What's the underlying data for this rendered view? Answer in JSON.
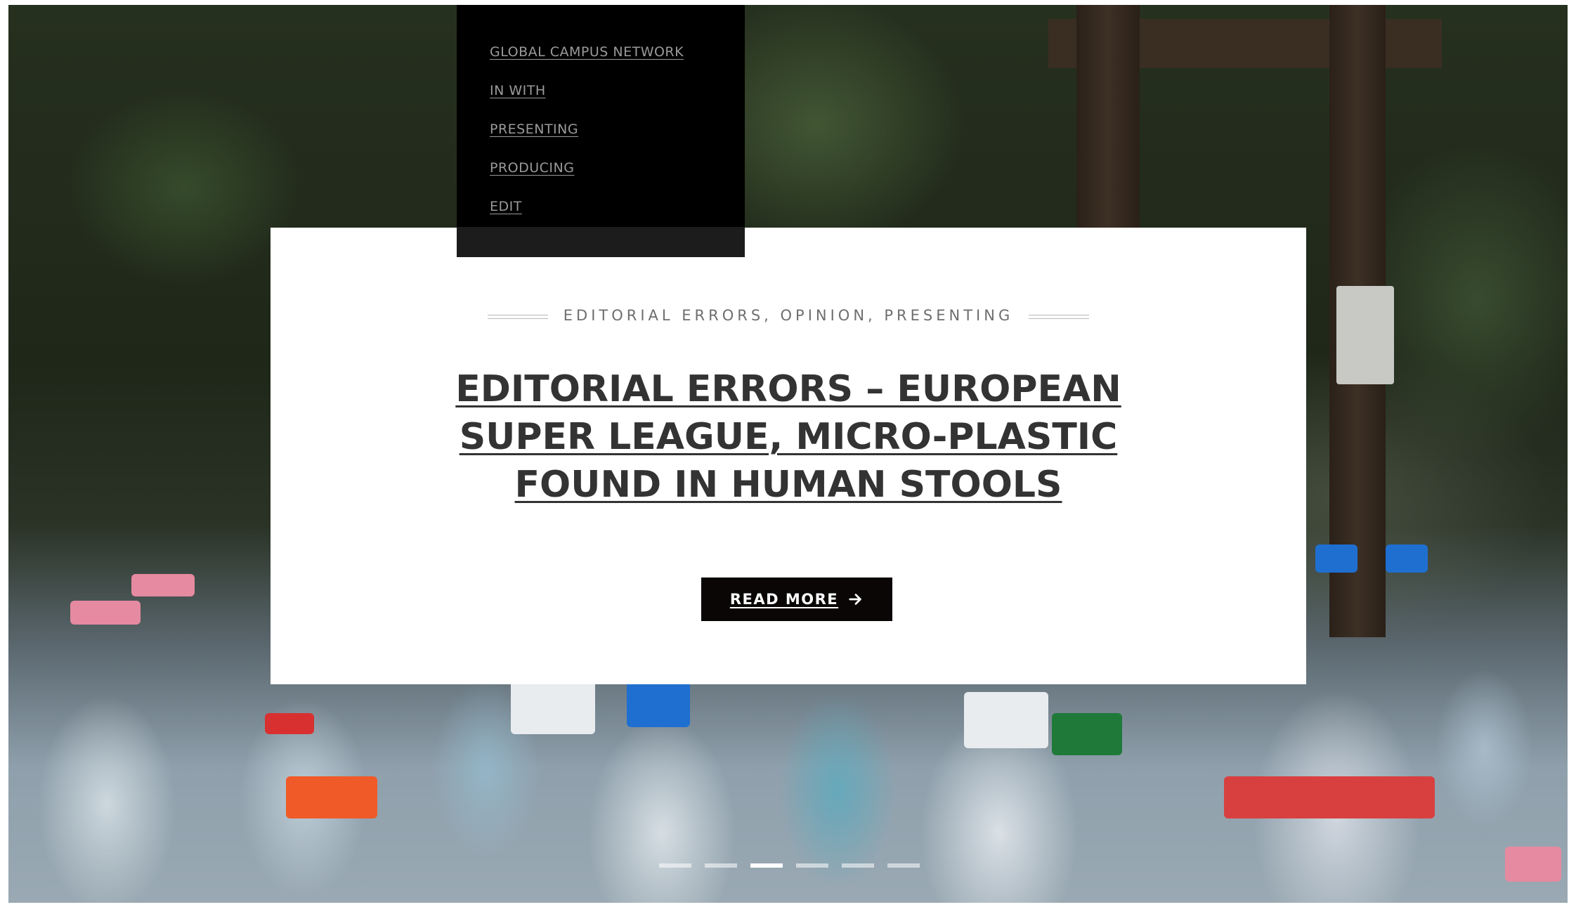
{
  "menu": {
    "items": [
      {
        "label": "GLOBAL CAMPUS NETWORK"
      },
      {
        "label": "IN WITH"
      },
      {
        "label": "PRESENTING"
      },
      {
        "label": "PRODUCING"
      },
      {
        "label": "EDIT"
      }
    ]
  },
  "slide": {
    "categories": "EDITORIAL ERRORS, OPINION, PRESENTING",
    "title": "EDITORIAL ERRORS – EUROPEAN SUPER LEAGUE, MICRO-PLASTIC FOUND IN HUMAN STOOLS",
    "read_more_label": "READ MORE",
    "read_more_icon": "arrow-right-icon"
  },
  "slider": {
    "total_slides": 6,
    "active_index": 2
  },
  "colors": {
    "menu_bg": "#000000",
    "menu_text": "#9a9a9a",
    "title_text": "#333333",
    "button_bg": "#0a0606",
    "button_text": "#ffffff"
  }
}
